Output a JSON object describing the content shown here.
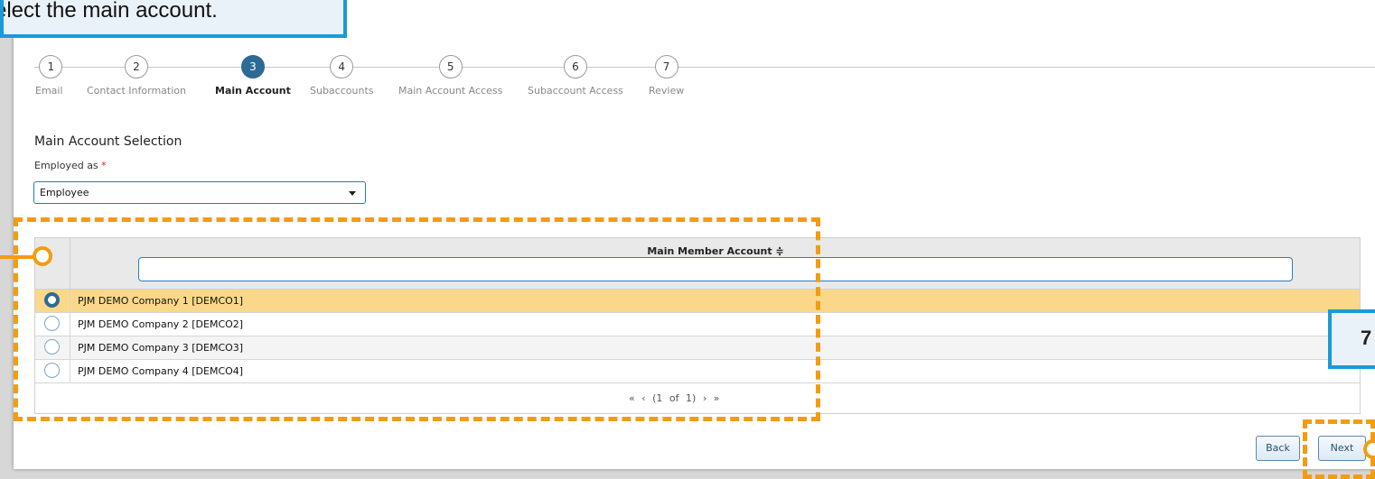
{
  "callout": {
    "text": "elect the main account."
  },
  "step_marker": {
    "text": "7"
  },
  "wizard": {
    "steps": [
      {
        "number": "1",
        "label": "Email"
      },
      {
        "number": "2",
        "label": "Contact Information"
      },
      {
        "number": "3",
        "label": "Main Account",
        "active": true
      },
      {
        "number": "4",
        "label": "Subaccounts"
      },
      {
        "number": "5",
        "label": "Main Account Access"
      },
      {
        "number": "6",
        "label": "Subaccount Access"
      },
      {
        "number": "7",
        "label": "Review"
      }
    ]
  },
  "form": {
    "section_title": "Main Account Selection",
    "employed_label": "Employed as",
    "required_mark": "*",
    "employed_value": "Employee"
  },
  "table": {
    "column_header": "Main Member Account ≑",
    "filter_value": "",
    "rows": [
      {
        "name": "PJM DEMO Company 1 [DEMCO1]",
        "selected": true
      },
      {
        "name": "PJM DEMO Company 2 [DEMCO2]",
        "selected": false
      },
      {
        "name": "PJM DEMO Company 3 [DEMCO3]",
        "selected": false
      },
      {
        "name": "PJM DEMO Company 4 [DEMCO4]",
        "selected": false
      }
    ],
    "pager": {
      "first": "«",
      "prev": "‹",
      "status": "(1 of 1)",
      "next": "›",
      "last": "»"
    }
  },
  "buttons": {
    "back": "Back",
    "next": "Next"
  },
  "colors": {
    "accent": "#2d6a95",
    "highlight": "#fbd889",
    "annotation": "#f39c12",
    "callout_border": "#1a9ad6"
  }
}
